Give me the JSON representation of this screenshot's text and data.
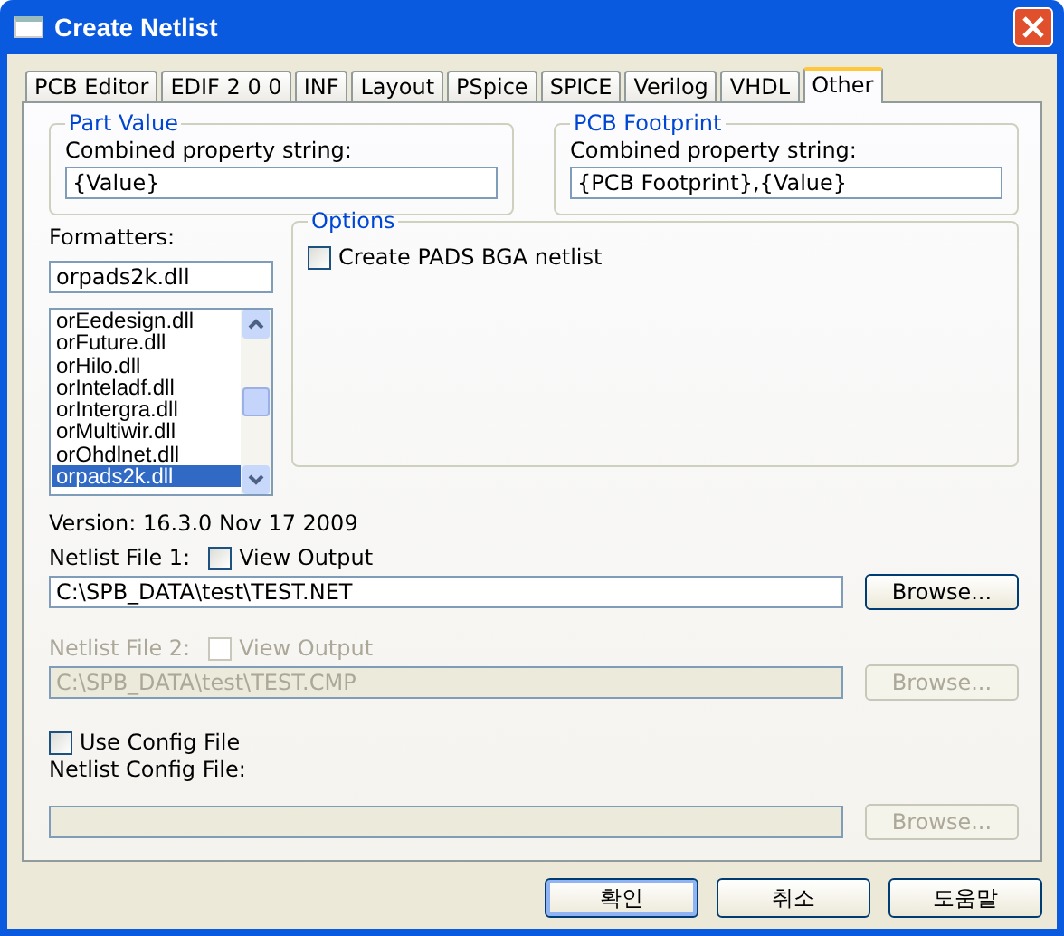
{
  "window": {
    "title": "Create Netlist"
  },
  "tabs": [
    {
      "label": "PCB Editor",
      "selected": false
    },
    {
      "label": "EDIF 2 0 0",
      "selected": false
    },
    {
      "label": "INF",
      "selected": false
    },
    {
      "label": "Layout",
      "selected": false
    },
    {
      "label": "PSpice",
      "selected": false
    },
    {
      "label": "SPICE",
      "selected": false
    },
    {
      "label": "Verilog",
      "selected": false
    },
    {
      "label": "VHDL",
      "selected": false
    },
    {
      "label": "Other",
      "selected": true
    }
  ],
  "part_value": {
    "title": "Part Value",
    "label": "Combined property string:",
    "value": "{Value}"
  },
  "pcb_footprint": {
    "title": "PCB Footprint",
    "label": "Combined property string:",
    "value": "{PCB Footprint},{Value}"
  },
  "formatters": {
    "label": "Formatters:",
    "value": "orpads2k.dll",
    "items": [
      {
        "label": "orEedesign.dll",
        "selected": false
      },
      {
        "label": "orFuture.dll",
        "selected": false
      },
      {
        "label": "orHilo.dll",
        "selected": false
      },
      {
        "label": "orInteladf.dll",
        "selected": false
      },
      {
        "label": "orIntergra.dll",
        "selected": false
      },
      {
        "label": "orMultiwir.dll",
        "selected": false
      },
      {
        "label": "orOhdlnet.dll",
        "selected": false
      },
      {
        "label": "orpads2k.dll",
        "selected": true
      }
    ]
  },
  "options": {
    "title": "Options",
    "items": [
      {
        "label": "Create PADS BGA netlist",
        "checked": false
      }
    ]
  },
  "version": "Version: 16.3.0  Nov 17 2009",
  "netlist_files": [
    {
      "label": "Netlist File 1:",
      "view_output": {
        "label": "View Output",
        "checked": false
      },
      "value": "C:\\SPB_DATA\\test\\TEST.NET",
      "browse": "Browse...",
      "disabled": false
    },
    {
      "label": "Netlist File 2:",
      "view_output": {
        "label": "View Output",
        "checked": false
      },
      "value": "C:\\SPB_DATA\\test\\TEST.CMP",
      "browse": "Browse...",
      "disabled": true
    }
  ],
  "config": {
    "use_config": {
      "label": "Use Config File",
      "checked": false
    },
    "label": "Netlist Config File:",
    "browse": "Browse...",
    "disabled": true
  },
  "buttons": [
    {
      "label": "확인",
      "default": true
    },
    {
      "label": "취소",
      "default": false
    },
    {
      "label": "도움말",
      "default": false
    }
  ]
}
